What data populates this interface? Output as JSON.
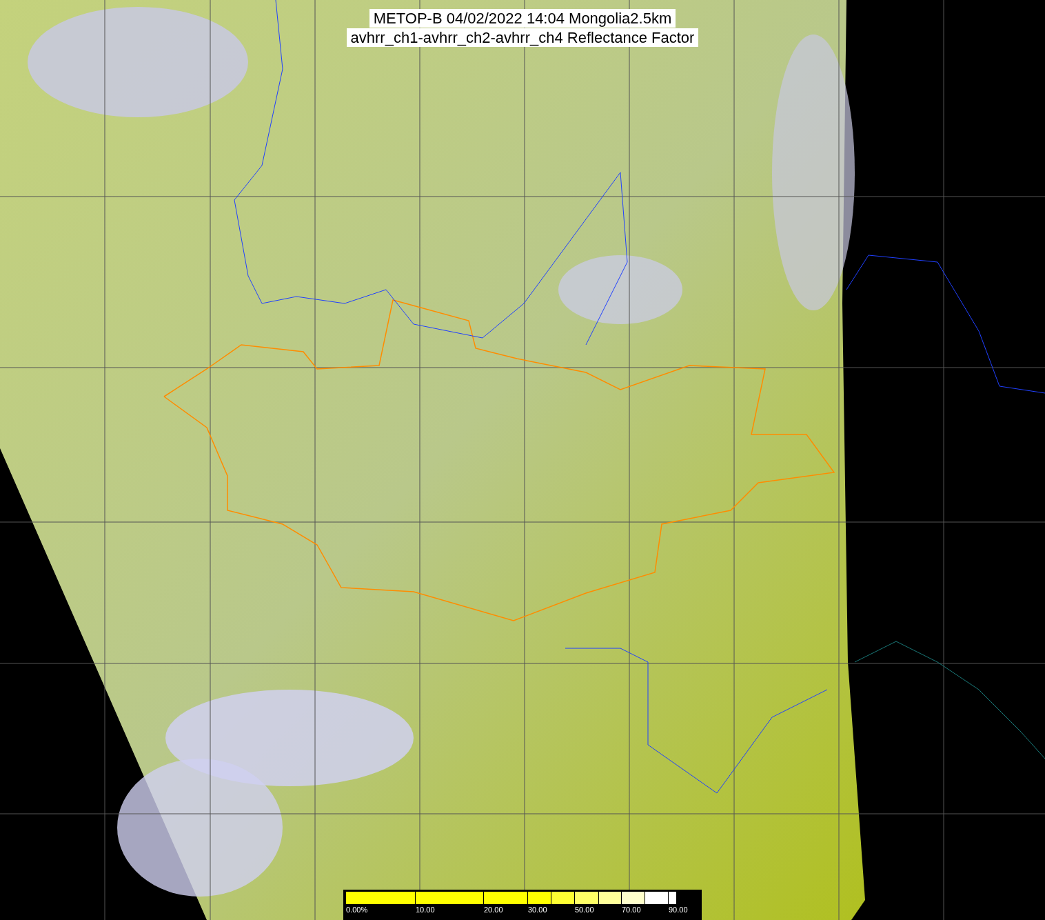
{
  "title": {
    "line_1": "METOP-B 04/02/2022 14:04 Mongolia2.5km",
    "line_2": "avhrr_ch1-avhrr_ch2-avhrr_ch4 Reflectance Factor"
  },
  "colorbar": {
    "segments": [
      {
        "color": "#ffff00"
      },
      {
        "color": "#ffff00"
      },
      {
        "color": "#ffff00"
      },
      {
        "color": "#ffff00"
      },
      {
        "color": "#ffff33"
      },
      {
        "color": "#ffff66"
      },
      {
        "color": "#ffff99"
      },
      {
        "color": "#ffffcc"
      },
      {
        "color": "#ffffff"
      },
      {
        "color": "#ffffff"
      }
    ],
    "ticks": [
      {
        "label": "0.00%"
      },
      {
        "label": "10.00"
      },
      {
        "label": "20.00"
      },
      {
        "label": "30.00"
      },
      {
        "label": "50.00"
      },
      {
        "label": "70.00"
      },
      {
        "label": "90.00"
      }
    ]
  }
}
